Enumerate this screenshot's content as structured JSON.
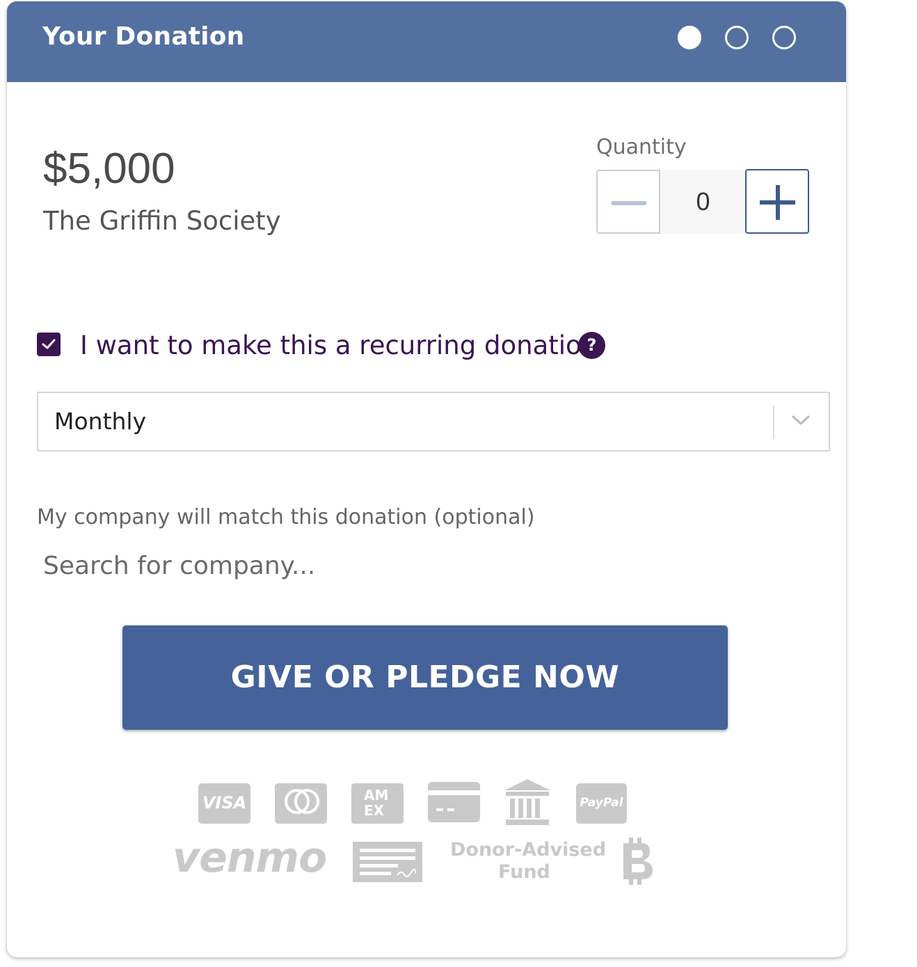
{
  "header": {
    "title": "Your Donation",
    "steps": [
      {
        "state": "active"
      },
      {
        "state": "inactive"
      },
      {
        "state": "inactive"
      }
    ]
  },
  "donation": {
    "amount": "$5,000",
    "name": "The Griffin Society"
  },
  "quantity": {
    "label": "Quantity",
    "value": "0",
    "decrement_icon": "minus-icon",
    "increment_icon": "plus-icon"
  },
  "recurring": {
    "checked": true,
    "label": "I want to make this a recurring donation",
    "help_icon": "?",
    "frequency": "Monthly"
  },
  "company_match": {
    "label": "My company will match this donation (optional)",
    "placeholder": "Search for company..."
  },
  "cta": {
    "label": "GIVE OR PLEDGE NOW"
  },
  "payment_methods": {
    "visa": "VISA",
    "mastercard": "mastercard-icon",
    "amex": "AM EX",
    "card": "credit-card-icon",
    "bank": "bank-icon",
    "paypal": "PayPal",
    "venmo": "venmo",
    "check": "check-icon",
    "daf_line1": "Donor-Advised",
    "daf_line2": "Fund",
    "bitcoin": "bitcoin-icon"
  },
  "colors": {
    "header": "#5370a0",
    "accent_purple": "#3a1552",
    "button": "#45629a",
    "payment_icons": "#c9c9c9"
  }
}
